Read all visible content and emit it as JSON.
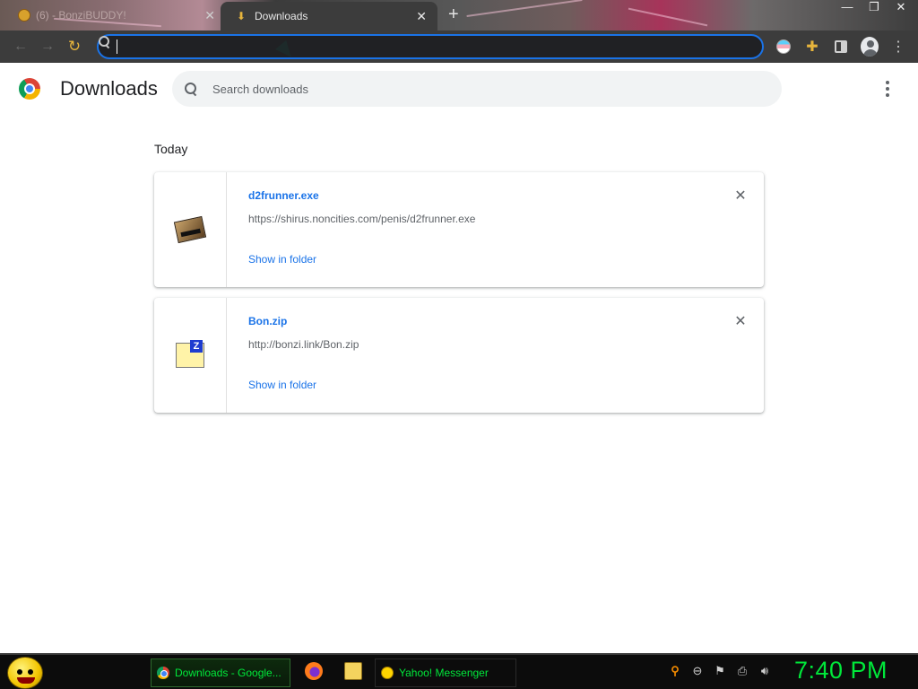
{
  "browser": {
    "tabs": [
      {
        "title": "(6) - BonziBUDDY!",
        "active": false,
        "icon": "bonzi-favicon"
      },
      {
        "title": "Downloads",
        "active": true,
        "icon": "download-favicon"
      }
    ],
    "new_tab_glyph": "+",
    "window_controls": [
      "minimize",
      "restore",
      "close"
    ],
    "omnibox": {
      "value": "",
      "placeholder": ""
    },
    "toolbar_icons": [
      "back-icon",
      "forward-icon",
      "reload-icon",
      "trans-flag-icon",
      "extensions-icon",
      "side-panel-icon",
      "profile-icon",
      "menu-icon"
    ]
  },
  "downloads_page": {
    "title": "Downloads",
    "search_placeholder": "Search downloads",
    "section_date": "Today",
    "items": [
      {
        "file_name": "d2frunner.exe",
        "url": "https://shirus.noncities.com/penis/d2frunner.exe",
        "action": "Show in folder",
        "icon": "exe-file-icon"
      },
      {
        "file_name": "Bon.zip",
        "url": "http://bonzi.link/Bon.zip",
        "action": "Show in folder",
        "icon": "zip-file-icon"
      }
    ],
    "remove_glyph": "✕"
  },
  "taskbar": {
    "items": [
      {
        "label": "Downloads - Google...",
        "icon": "chrome-icon"
      },
      {
        "label": "",
        "icon": "firefox-icon"
      },
      {
        "label": "",
        "icon": "folder-icon"
      },
      {
        "label": "Yahoo! Messenger",
        "icon": "yahoo-messenger-icon"
      }
    ],
    "tray_icons": [
      "search-icon",
      "minus-icon",
      "action-center-flag-icon",
      "network-icon",
      "volume-icon"
    ],
    "clock": "7:40 PM"
  },
  "colors": {
    "accent": "#1a73e8",
    "taskbar_text": "#00e83a",
    "toolbar_bg": "#3c3c3c"
  }
}
